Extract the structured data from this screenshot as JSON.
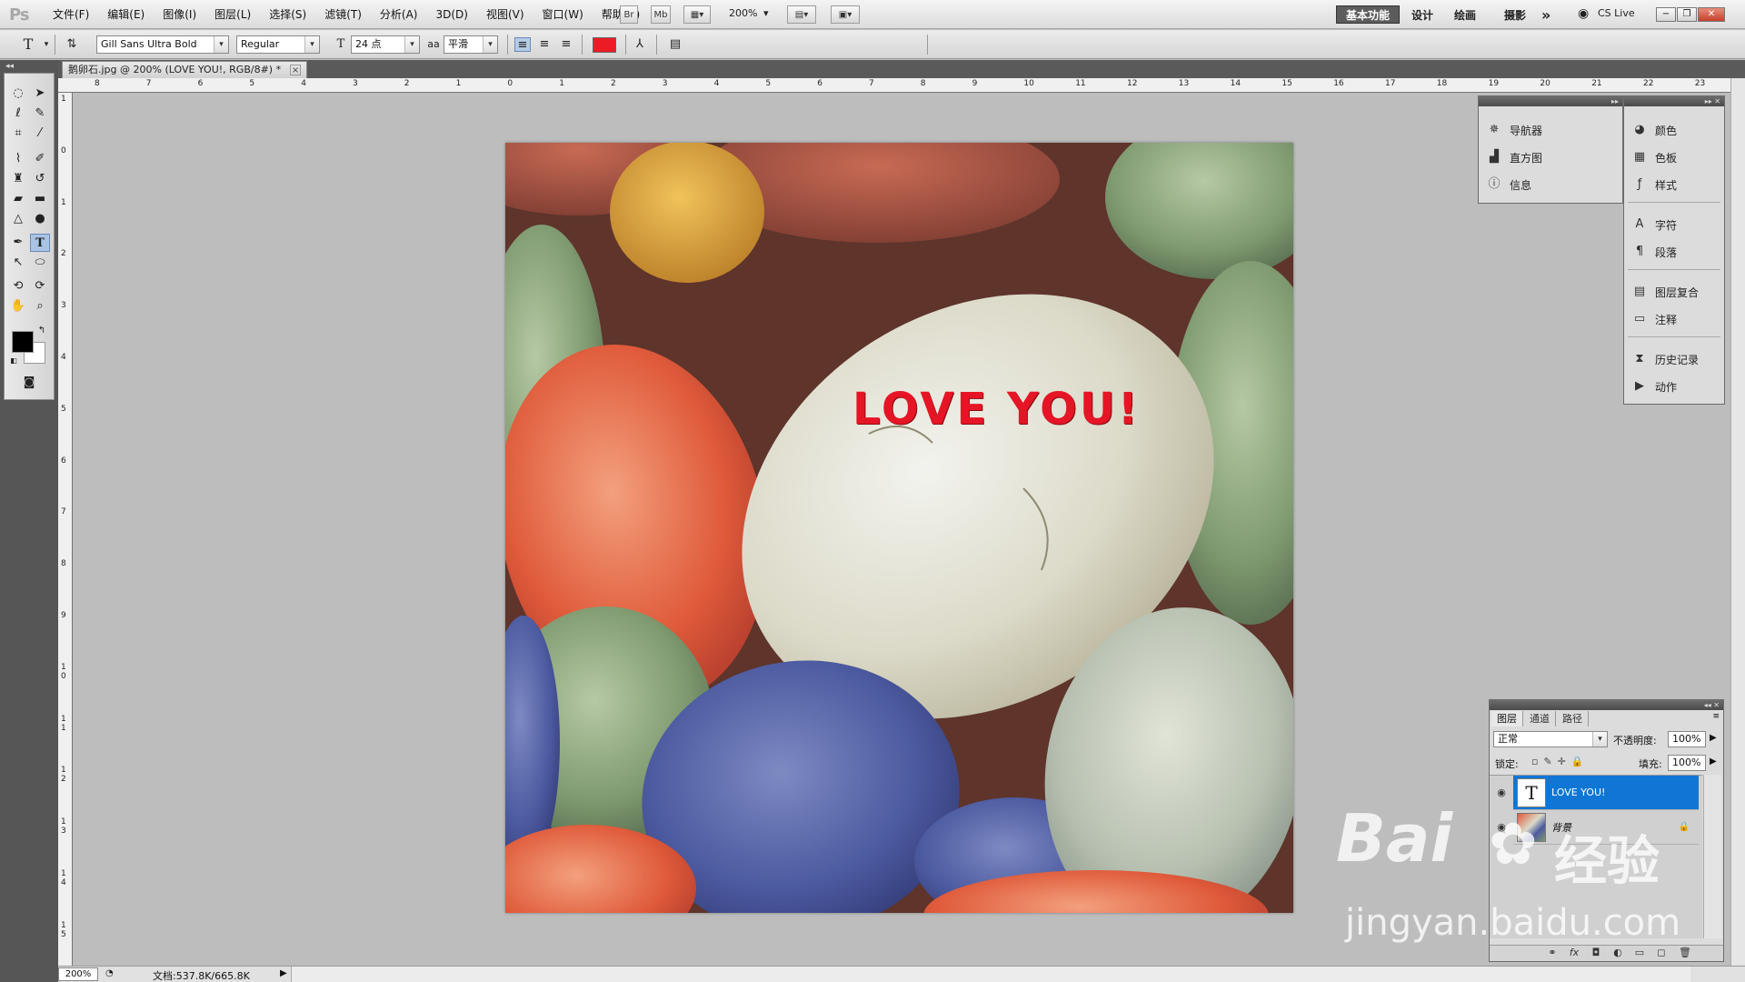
{
  "app": {
    "logo": "Ps",
    "menu": [
      "文件(F)",
      "编辑(E)",
      "图像(I)",
      "图层(L)",
      "选择(S)",
      "滤镜(T)",
      "分析(A)",
      "3D(D)",
      "视图(V)",
      "窗口(W)",
      "帮助(H)"
    ],
    "bridge_btn": "Br",
    "minibridge_btn": "Mb",
    "zoom_dropdown": "200%",
    "workspaces": [
      "基本功能",
      "设计",
      "绘画",
      "摄影"
    ],
    "more": "»",
    "cslive": "CS Live",
    "window_controls": [
      "−",
      "❐",
      "✕"
    ]
  },
  "options": {
    "tool_glyph": "T",
    "font_family": "Gill Sans Ultra Bold",
    "font_style": "Regular",
    "font_size": "24 点",
    "aa_label": "aa",
    "antialias": "平滑",
    "text_color": "#ec1c24"
  },
  "document": {
    "tab_title": "鹅卵石.jpg @ 200% (LOVE YOU!, RGB/8#) *",
    "close": "×",
    "text_layer_content": "LOVE YOU!"
  },
  "rulers": {
    "top": [
      "8",
      "7",
      "6",
      "5",
      "4",
      "3",
      "2",
      "1",
      "0",
      "1",
      "2",
      "3",
      "4",
      "5",
      "6",
      "7",
      "8",
      "9",
      "10",
      "11",
      "12",
      "13",
      "14",
      "15",
      "16",
      "17",
      "18",
      "19",
      "20",
      "21",
      "22",
      "23"
    ],
    "left": [
      "1",
      "0",
      "1",
      "2",
      "3",
      "4",
      "5",
      "6",
      "7",
      "8",
      "9",
      "1 0",
      "1 1",
      "1 2",
      "1 3",
      "1 4",
      "1 5"
    ]
  },
  "panels": {
    "group1": [
      {
        "icon": "navigator-icon",
        "label": "导航器"
      },
      {
        "icon": "histogram-icon",
        "label": "直方图"
      },
      {
        "icon": "info-icon",
        "label": "信息"
      }
    ],
    "group2": [
      {
        "icon": "color-icon",
        "label": "颜色"
      },
      {
        "icon": "swatches-icon",
        "label": "色板"
      },
      {
        "icon": "styles-icon",
        "label": "样式"
      }
    ],
    "group3": [
      {
        "icon": "character-icon",
        "label": "字符"
      },
      {
        "icon": "paragraph-icon",
        "label": "段落"
      }
    ],
    "group4": [
      {
        "icon": "layer-comps-icon",
        "label": "图层复合"
      },
      {
        "icon": "notes-icon",
        "label": "注释"
      }
    ],
    "group5": [
      {
        "icon": "history-icon",
        "label": "历史记录"
      },
      {
        "icon": "actions-icon",
        "label": "动作"
      }
    ]
  },
  "layers": {
    "tabs": [
      "图层",
      "通道",
      "路径"
    ],
    "blend_mode": "正常",
    "opacity_label": "不透明度:",
    "opacity": "100%",
    "lock_label": "锁定:",
    "fill_label": "填充:",
    "fill": "100%",
    "items": [
      {
        "name": "LOVE YOU!",
        "thumb": "T",
        "selected": true
      },
      {
        "name": "背景",
        "thumb": "",
        "selected": false,
        "locked": true
      }
    ]
  },
  "status": {
    "zoom": "200%",
    "doc_size": "文档:537.8K/665.8K"
  },
  "watermark": {
    "brand": "Bai",
    "brand2": "经验",
    "url": "jingyan.baidu.com"
  }
}
